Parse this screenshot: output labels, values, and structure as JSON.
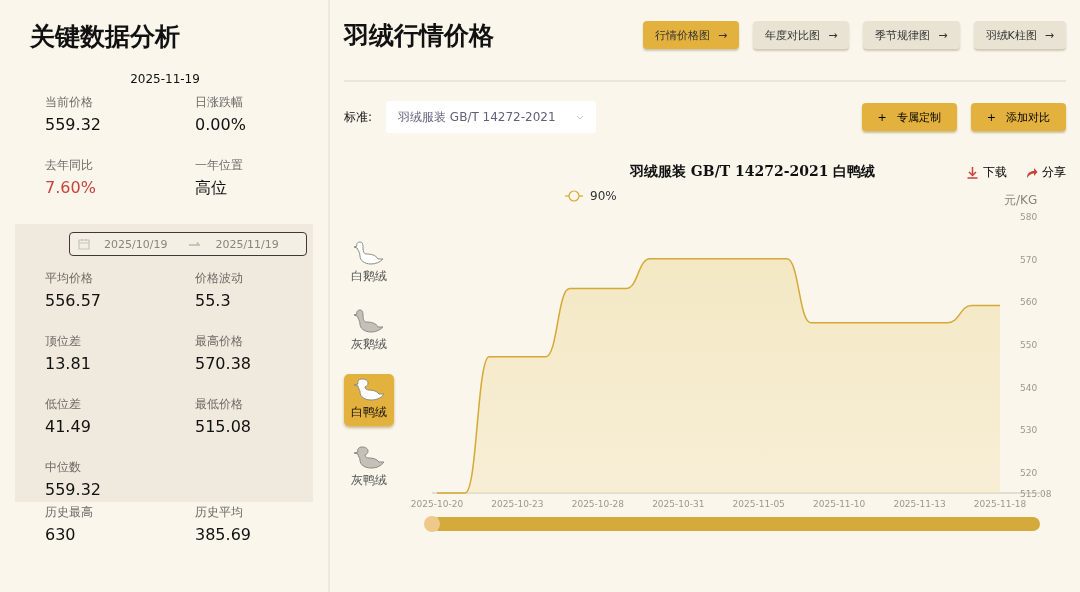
{
  "sidebar": {
    "title": "关键数据分析",
    "summary": {
      "date": "2025-11-19",
      "stats": [
        {
          "label": "当前价格",
          "value": "559.32"
        },
        {
          "label": "日涨跌幅",
          "value": "0.00%"
        },
        {
          "label": "去年同比",
          "value": "7.60%",
          "color": "#c8433a"
        },
        {
          "label": "一年位置",
          "value": "高位"
        }
      ]
    },
    "range": {
      "start": "2025/10/19",
      "end": "2025/11/19",
      "stats": [
        {
          "label": "平均价格",
          "value": "556.57"
        },
        {
          "label": "价格波动",
          "value": "55.3"
        },
        {
          "label": "顶位差",
          "value": "13.81"
        },
        {
          "label": "最高价格",
          "value": "570.38"
        },
        {
          "label": "低位差",
          "value": "41.49"
        },
        {
          "label": "最低价格",
          "value": "515.08"
        },
        {
          "label": "中位数",
          "value": "559.32"
        }
      ]
    },
    "history": {
      "stats": [
        {
          "label": "历史最高",
          "value": "630"
        },
        {
          "label": "历史平均",
          "value": "385.69"
        }
      ]
    }
  },
  "main": {
    "title": "羽绒行情价格",
    "tabs": [
      {
        "label": "行情价格图",
        "arrow": "→",
        "selected": true
      },
      {
        "label": "年度对比图",
        "arrow": "→",
        "selected": false
      },
      {
        "label": "季节规律图",
        "arrow": "→",
        "selected": false
      },
      {
        "label": "羽绒K柱图",
        "arrow": "→",
        "selected": false
      }
    ],
    "standard": {
      "label": "标准:",
      "value": "羽绒服装 GB/T 14272-2021"
    },
    "actions": [
      {
        "icon": "+",
        "label": "专属定制"
      },
      {
        "icon": "+",
        "label": "添加对比"
      }
    ],
    "chart_title": "羽绒服装 GB/T 14272-2021 白鸭绒",
    "tools": [
      {
        "kind": "download",
        "label": "下载"
      },
      {
        "kind": "share",
        "label": "分享"
      }
    ],
    "materials": [
      {
        "kind": "goose",
        "label": "白鹅绒",
        "color": "#ffffff",
        "selected": false
      },
      {
        "kind": "goose",
        "label": "灰鹅绒",
        "color": "#c4c0b8",
        "selected": false
      },
      {
        "kind": "duck",
        "label": "白鸭绒",
        "color": "#ffffff",
        "selected": true
      },
      {
        "kind": "duck",
        "label": "灰鸭绒",
        "color": "#c4c0b8",
        "selected": false
      }
    ],
    "chart_data": {
      "type": "area",
      "ylabel": "元/KG",
      "categories": [
        "2025-10-20",
        "2025-10-23",
        "2025-10-28",
        "2025-10-31",
        "2025-11-05",
        "2025-11-10",
        "2025-11-13",
        "2025-11-18"
      ],
      "series": [
        {
          "name": "90%",
          "color": "#d4a935",
          "values": [
            515.08,
            547,
            563,
            570,
            570,
            555,
            555,
            559
          ]
        }
      ],
      "ylim": [
        515.08,
        580
      ],
      "yticks": [
        {
          "value": 515.08,
          "label": "515.08"
        },
        520,
        530,
        540,
        550,
        560,
        570,
        580
      ]
    }
  }
}
